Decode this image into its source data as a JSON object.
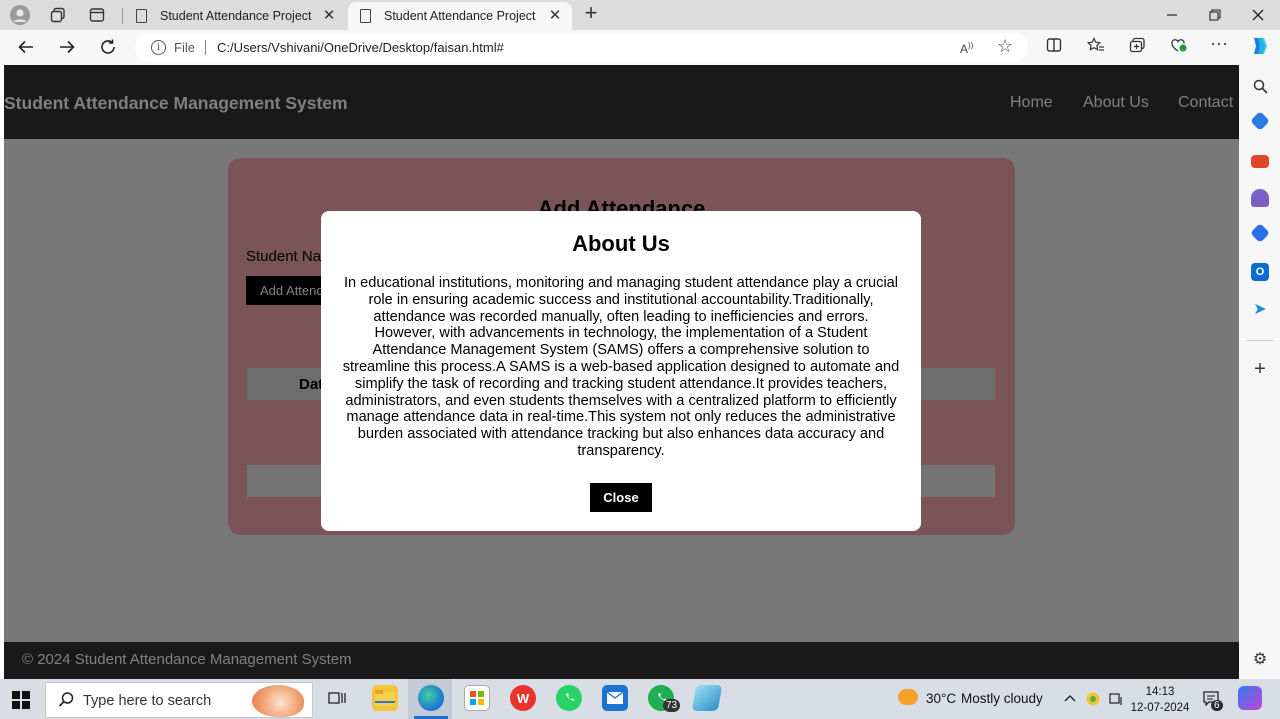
{
  "browser": {
    "tabs": [
      {
        "title": "Student Attendance Project",
        "close": "✕"
      },
      {
        "title": "Student Attendance Project",
        "close": "✕"
      }
    ],
    "new_tab": "+",
    "address": {
      "prefix": "File",
      "url": "C:/Users/Vshivani/OneDrive/Desktop/faisan.html#"
    }
  },
  "site": {
    "title": "Student Attendance Management System",
    "nav": [
      "Home",
      "About Us",
      "Contact"
    ],
    "card": {
      "title": "Add Attendance",
      "student_label": "Student Na",
      "add_button": "Add Attend",
      "table_header_date": "Dat"
    },
    "footer": "© 2024 Student Attendance Management System"
  },
  "modal": {
    "title": "About Us",
    "body": "In educational institutions, monitoring and managing student attendance play a crucial role in ensuring academic success and institutional accountability.Traditionally, attendance was recorded manually, often leading to inefficiencies and errors. However, with advancements in technology, the implementation of a Student Attendance Management System (SAMS) offers a comprehensive solution to streamline this process.A SAMS is a web-based application designed to automate and simplify the task of recording and tracking student attendance.It provides teachers, administrators, and even students themselves with a centralized platform to efficiently manage attendance data in real-time.This system not only reduces the administrative burden associated with attendance tracking but also enhances data accuracy and transparency.",
    "close_button": "Close"
  },
  "taskbar": {
    "search_placeholder": "Type here to search",
    "whatsapp_badge": "73",
    "weather": {
      "temp": "30°C",
      "condition": "Mostly cloudy"
    },
    "clock": {
      "time": "14:13",
      "date": "12-07-2024"
    },
    "notification_count": "6"
  },
  "colors": {
    "header": "#333333",
    "card": "#f5a9b0",
    "modal": "#ffffff",
    "button": "#000000"
  }
}
